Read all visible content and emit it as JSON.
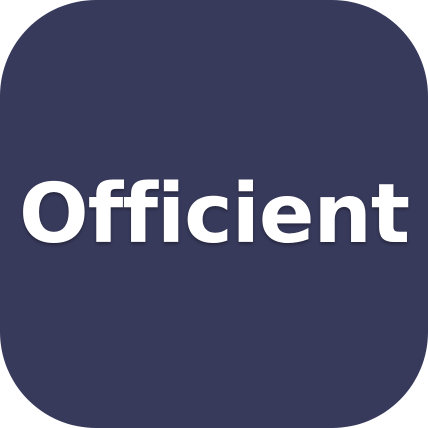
{
  "app_icon": {
    "wordmark": "Officient",
    "background_color": "#383a5c",
    "text_color": "#ffffff"
  }
}
